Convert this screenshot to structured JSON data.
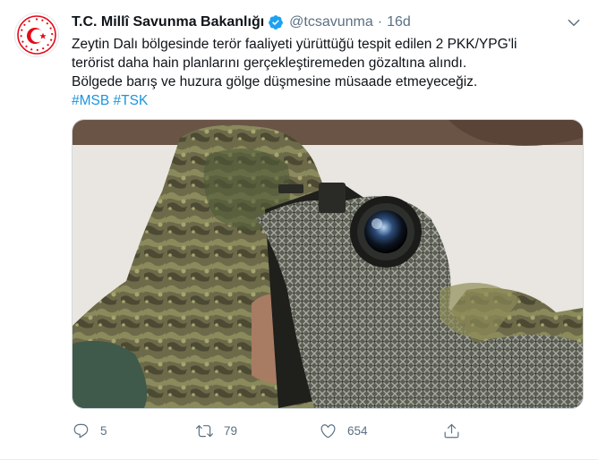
{
  "tweet": {
    "display_name": "T.C. Millî Savunma Bakanlığı",
    "handle": "@tcsavunma",
    "separator": "·",
    "time": "16d",
    "text_lines": [
      "Zeytin Dalı bölgesinde terör faaliyeti yürüttüğü tespit edilen 2 PKK/YPG'li",
      "terörist daha hain planlarını gerçekleştiremeden gözaltına alındı.",
      "Bölgede barış ve huzura gölge düşmesine müsaade etmeyeceğiz."
    ],
    "hashtags": [
      "#MSB",
      "#TSK"
    ],
    "counts": {
      "reply": "5",
      "retweet": "79",
      "like": "654"
    }
  },
  "icons": {
    "verified": "verified-badge-icon",
    "caret": "chevron-down-icon",
    "reply": "reply-icon",
    "retweet": "retweet-icon",
    "like": "heart-icon",
    "share": "share-icon"
  },
  "colors": {
    "accent": "#1b95e0",
    "secondary_text": "#5b7083",
    "avatar_red": "#e30a17"
  }
}
